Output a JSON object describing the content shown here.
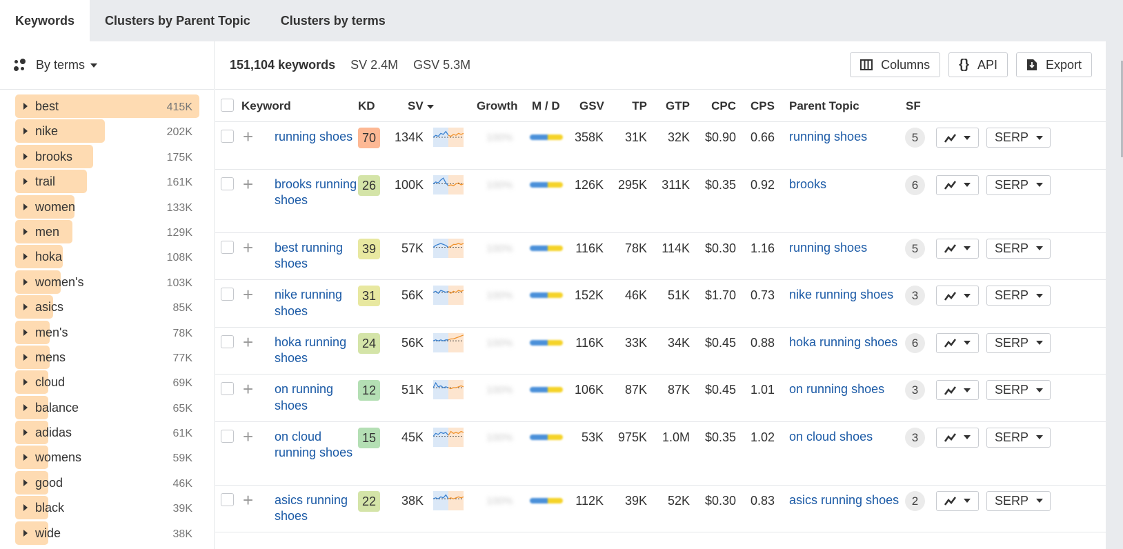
{
  "tabs": [
    {
      "label": "Keywords",
      "active": true
    },
    {
      "label": "Clusters by Parent Topic",
      "active": false
    },
    {
      "label": "Clusters by terms",
      "active": false
    }
  ],
  "sidebar": {
    "grouping_label": "By terms",
    "grouping_icon": "cluster-dots-icon",
    "bar_color": "#fedbb2",
    "terms": [
      {
        "name": "best",
        "count": "415K",
        "value": 415
      },
      {
        "name": "nike",
        "count": "202K",
        "value": 202
      },
      {
        "name": "brooks",
        "count": "175K",
        "value": 175
      },
      {
        "name": "trail",
        "count": "161K",
        "value": 161
      },
      {
        "name": "women",
        "count": "133K",
        "value": 133
      },
      {
        "name": "men",
        "count": "129K",
        "value": 129
      },
      {
        "name": "hoka",
        "count": "108K",
        "value": 108
      },
      {
        "name": "women's",
        "count": "103K",
        "value": 103
      },
      {
        "name": "asics",
        "count": "85K",
        "value": 85
      },
      {
        "name": "men's",
        "count": "78K",
        "value": 78
      },
      {
        "name": "mens",
        "count": "77K",
        "value": 77
      },
      {
        "name": "cloud",
        "count": "69K",
        "value": 69
      },
      {
        "name": "balance",
        "count": "65K",
        "value": 65
      },
      {
        "name": "adidas",
        "count": "61K",
        "value": 61
      },
      {
        "name": "womens",
        "count": "59K",
        "value": 59
      },
      {
        "name": "good",
        "count": "46K",
        "value": 46
      },
      {
        "name": "black",
        "count": "39K",
        "value": 39
      },
      {
        "name": "wide",
        "count": "38K",
        "value": 38
      }
    ]
  },
  "toolbar": {
    "keyword_count": "151,104 keywords",
    "sv": "SV 2.4M",
    "gsv": "GSV 5.3M",
    "columns_label": "Columns",
    "api_label": "API",
    "export_label": "Export"
  },
  "table": {
    "headers": {
      "keyword": "Keyword",
      "kd": "KD",
      "sv": "SV",
      "growth": "Growth",
      "md": "M / D",
      "gsv": "GSV",
      "tp": "TP",
      "gtp": "GTP",
      "cpc": "CPC",
      "cps": "CPS",
      "parent_topic": "Parent Topic",
      "sf": "SF"
    },
    "sort_column": "SV",
    "sort_direction": "desc",
    "growth_placeholder": "100%",
    "serp_label": "SERP",
    "link_color": "#1b5aa6",
    "rows": [
      {
        "keyword": "running shoes",
        "kd": "70",
        "kd_color": "#fdb894",
        "sv": "134K",
        "gsv": "358K",
        "tp": "31K",
        "gtp": "32K",
        "cpc": "$0.90",
        "cps": "0.66",
        "parent_topic": "running shoes",
        "sf": "5",
        "lines": 2,
        "trend": [
          0.5,
          0.6,
          0.55,
          0.7,
          0.65,
          0.8,
          0.6,
          0.55,
          0.65,
          0.6,
          0.7,
          0.65,
          0.7
        ]
      },
      {
        "keyword": "brooks running shoes",
        "kd": "26",
        "kd_color": "#d4e4a8",
        "sv": "100K",
        "gsv": "126K",
        "tp": "295K",
        "gtp": "311K",
        "cpc": "$0.35",
        "cps": "0.92",
        "parent_topic": "brooks",
        "sf": "6",
        "lines": 3,
        "trend": [
          0.55,
          0.65,
          0.6,
          0.75,
          0.85,
          0.6,
          0.45,
          0.5,
          0.45,
          0.55,
          0.6,
          0.5,
          0.55
        ]
      },
      {
        "keyword": "best running shoes",
        "kd": "39",
        "kd_color": "#e8e8a0",
        "sv": "57K",
        "gsv": "116K",
        "tp": "78K",
        "gtp": "114K",
        "cpc": "$0.30",
        "cps": "1.16",
        "parent_topic": "running shoes",
        "sf": "5",
        "lines": 2,
        "trend": [
          0.55,
          0.65,
          0.7,
          0.75,
          0.7,
          0.65,
          0.55,
          0.6,
          0.7,
          0.7,
          0.75,
          0.7,
          0.75
        ]
      },
      {
        "keyword": "nike running shoes",
        "kd": "31",
        "kd_color": "#e8e8a0",
        "sv": "56K",
        "gsv": "152K",
        "tp": "46K",
        "gtp": "51K",
        "cpc": "$1.70",
        "cps": "0.73",
        "parent_topic": "nike running shoes",
        "sf": "3",
        "lines": 2,
        "trend": [
          0.65,
          0.7,
          0.6,
          0.75,
          0.7,
          0.65,
          0.7,
          0.6,
          0.7,
          0.65,
          0.75,
          0.7,
          0.75
        ]
      },
      {
        "keyword": "hoka running shoes",
        "kd": "24",
        "kd_color": "#d4e4a8",
        "sv": "56K",
        "gsv": "116K",
        "tp": "33K",
        "gtp": "34K",
        "cpc": "$0.45",
        "cps": "0.88",
        "parent_topic": "hoka running shoes",
        "sf": "6",
        "lines": 2,
        "trend": [
          0.6,
          0.65,
          0.6,
          0.65,
          0.6,
          0.65,
          0.65,
          0.7,
          0.7,
          0.75,
          0.8,
          0.85,
          0.9
        ]
      },
      {
        "keyword": "on running shoes",
        "kd": "12",
        "kd_color": "#b4dfb4",
        "sv": "51K",
        "gsv": "106K",
        "tp": "87K",
        "gtp": "87K",
        "cpc": "$0.45",
        "cps": "1.01",
        "parent_topic": "on running shoes",
        "sf": "3",
        "lines": 2,
        "trend": [
          0.6,
          0.85,
          0.65,
          0.7,
          0.6,
          0.65,
          0.6,
          0.55,
          0.6,
          0.6,
          0.65,
          0.7,
          0.65
        ]
      },
      {
        "keyword": "on cloud running shoes",
        "kd": "15",
        "kd_color": "#b4dfb4",
        "sv": "45K",
        "gsv": "53K",
        "tp": "975K",
        "gtp": "1.0M",
        "cpc": "$0.35",
        "cps": "1.02",
        "parent_topic": "on cloud shoes",
        "sf": "3",
        "lines": 3,
        "trend": [
          0.55,
          0.7,
          0.65,
          0.75,
          0.7,
          0.75,
          0.6,
          0.8,
          0.7,
          0.75,
          0.7,
          0.8,
          0.75
        ]
      },
      {
        "keyword": "asics running shoes",
        "kd": "22",
        "kd_color": "#d4e4a8",
        "sv": "38K",
        "gsv": "112K",
        "tp": "39K",
        "gtp": "52K",
        "cpc": "$0.30",
        "cps": "0.83",
        "parent_topic": "asics running shoes",
        "sf": "2",
        "lines": 2,
        "trend": [
          0.6,
          0.65,
          0.6,
          0.7,
          0.65,
          0.8,
          0.6,
          0.65,
          0.6,
          0.65,
          0.7,
          0.65,
          0.7
        ]
      }
    ]
  }
}
